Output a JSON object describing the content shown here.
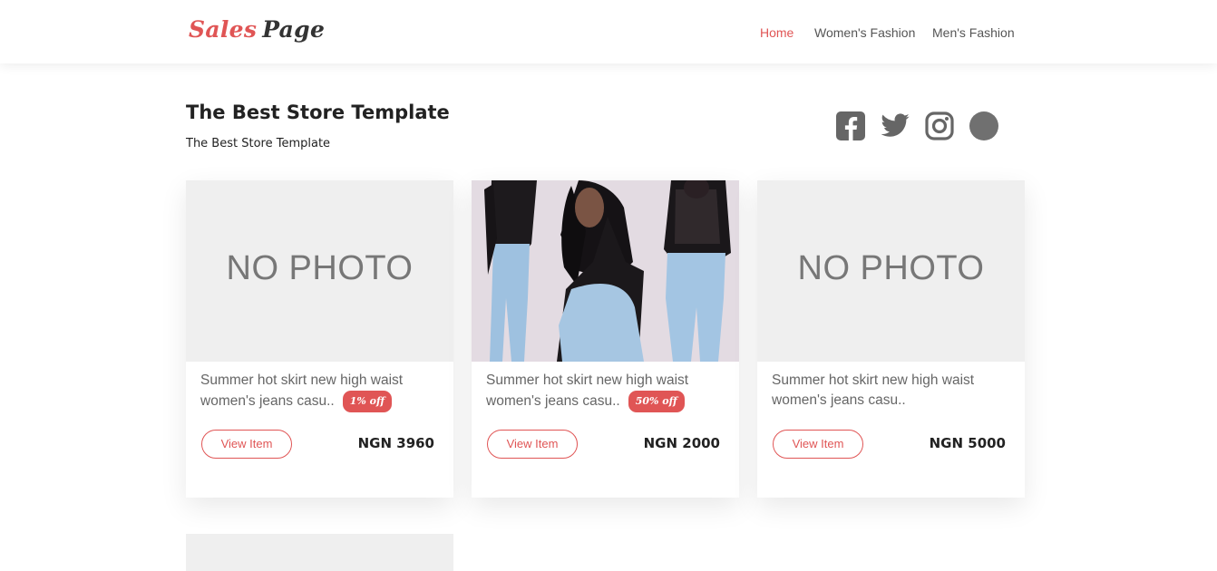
{
  "brand": {
    "part1": "Sales",
    "part2": "Page"
  },
  "nav": [
    {
      "label": "Home",
      "active": true
    },
    {
      "label": "Women's Fashion",
      "active": false
    },
    {
      "label": "Men's Fashion",
      "active": false
    }
  ],
  "heading": {
    "title": "The Best Store Template",
    "subtitle": "The Best Store Template"
  },
  "social": [
    "facebook-icon",
    "twitter-icon",
    "instagram-icon",
    "circle-icon"
  ],
  "colors": {
    "accent": "#e05555",
    "icon": "#666666",
    "placeholder_bg": "#efefef"
  },
  "products": [
    {
      "image": "NO PHOTO",
      "desc_line1": "Summer hot skirt new high waist",
      "desc_line2": "women's jeans casu..",
      "badge": "1% off",
      "button": "View Item",
      "price": "NGN 3960"
    },
    {
      "image": "photo",
      "desc_line1": "Summer hot skirt new high waist",
      "desc_line2": "women's jeans casu..",
      "badge": "50% off",
      "button": "View Item",
      "price": "NGN 2000"
    },
    {
      "image": "NO PHOTO",
      "desc_line1": "Summer hot skirt new high waist",
      "desc_line2": "women's jeans casu..",
      "badge": "",
      "button": "View Item",
      "price": "NGN 5000"
    }
  ]
}
